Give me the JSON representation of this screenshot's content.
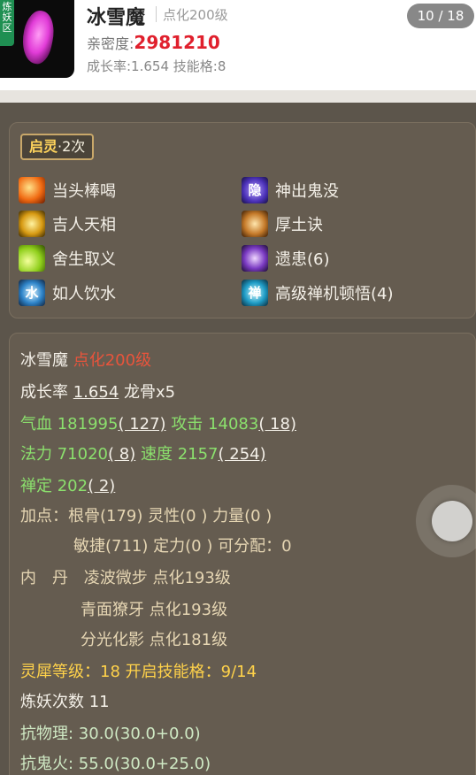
{
  "header": {
    "avatar_badge": "炼\n妖\n区",
    "name": "冰雪魔",
    "name_sub": "点化200级",
    "page_indicator": "10 / 18",
    "intimacy_label": "亲密度:",
    "intimacy_value": "2981210",
    "growth_line": "成长率:1.654  技能格:8"
  },
  "skills_panel": {
    "badge_title": "启灵",
    "badge_count": "·2次",
    "skills": [
      {
        "label": "当头棒喝",
        "icon": "fire-burst-icon"
      },
      {
        "label": "神出鬼没",
        "icon": "stealth-icon",
        "glyph": "隐"
      },
      {
        "label": "吉人天相",
        "icon": "golden-aura-icon"
      },
      {
        "label": "厚土诀",
        "icon": "earth-icon"
      },
      {
        "label": "舍生取义",
        "icon": "sacrifice-icon"
      },
      {
        "label": "遗患(6)",
        "icon": "curse-icon"
      },
      {
        "label": "如人饮水",
        "icon": "water-icon",
        "glyph": "水"
      },
      {
        "label": "高级禅机顿悟(4)",
        "icon": "zen-icon",
        "glyph": "禅"
      }
    ]
  },
  "detail_panel": {
    "name": "冰雪魔",
    "name_sub": "点化200级",
    "growth_label": "成长率",
    "growth_value": "1.654",
    "dragon_bone": "龙骨x5",
    "hp_label": "气血",
    "hp_value": "181995",
    "hp_bonus": "( 127)",
    "atk_label": "攻击",
    "atk_value": "14083",
    "atk_bonus": "( 18)",
    "mp_label": "法力",
    "mp_value": "71020",
    "mp_bonus": "( 8)",
    "spd_label": "速度",
    "spd_value": "2157",
    "spd_bonus": "( 254)",
    "zen_label": "禅定",
    "zen_value": "202",
    "zen_bonus": "( 2)",
    "points_line1": "加点：根骨(179) 灵性(0 ) 力量(0 )",
    "points_line2": "敏捷(711) 定力(0 ) 可分配：0",
    "core_label": "内　丹",
    "cores": [
      "凌波微步 点化193级",
      "青面獠牙 点化193级",
      "分光化影 点化181级"
    ],
    "rhino_line": "灵犀等级：18 开启技能格：9/14",
    "refine_line": "炼妖次数 11",
    "phys_resist": "抗物理: 30.0(30.0+0.0)",
    "ghost_fire_resist": "抗鬼火: 55.0(30.0+25.0)"
  },
  "colors": {
    "intimacy": "#e0202d",
    "green_stat": "#8be06d",
    "red_level": "#e8543c",
    "gold_stat": "#ffd24a",
    "panel_bg": "#655c50"
  }
}
